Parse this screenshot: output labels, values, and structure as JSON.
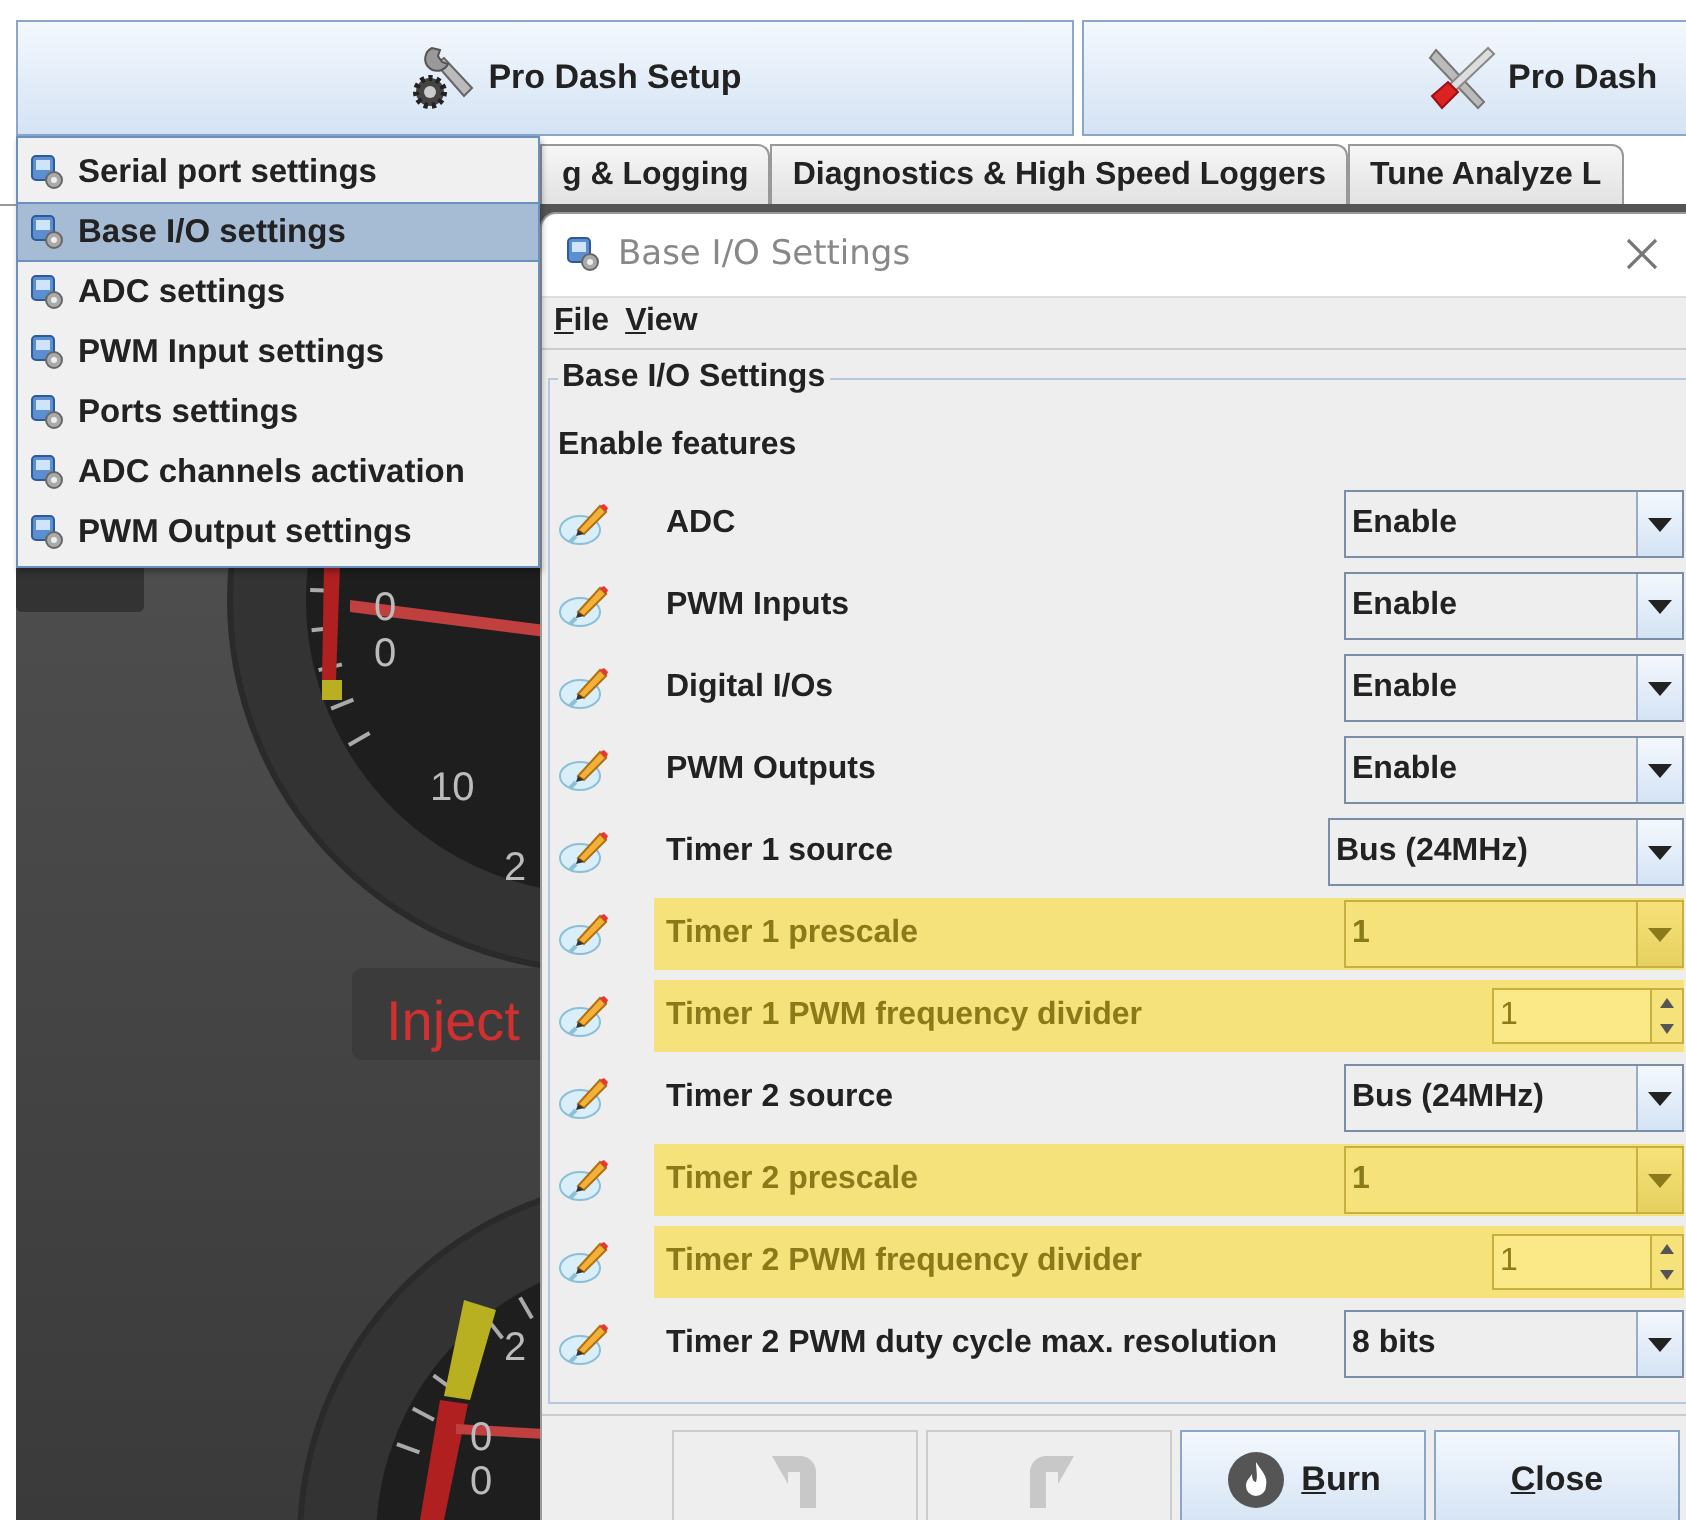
{
  "toolbar": {
    "buttons": [
      {
        "label": "Pro Dash Setup"
      },
      {
        "label": "Pro Dash"
      }
    ]
  },
  "tabs": [
    {
      "label": "g & Logging",
      "selected": false
    },
    {
      "label": "Diagnostics & High Speed Loggers",
      "selected": false
    },
    {
      "label": "Tune Analyze L",
      "selected": false
    }
  ],
  "popup_menu": {
    "items": [
      {
        "label": "Serial port settings",
        "selected": false
      },
      {
        "label": "Base I/O settings",
        "selected": true
      },
      {
        "label": "ADC settings",
        "selected": false
      },
      {
        "label": "PWM Input settings",
        "selected": false
      },
      {
        "label": "Ports settings",
        "selected": false
      },
      {
        "label": "ADC channels activation",
        "selected": false
      },
      {
        "label": "PWM Output settings",
        "selected": false
      }
    ]
  },
  "dashboard": {
    "gauges": [
      {
        "labels": [
          "0",
          "0",
          "10",
          "2"
        ]
      },
      {
        "labels": [
          "2",
          "0",
          "0"
        ]
      }
    ],
    "indicator": "Inject"
  },
  "dialog": {
    "title": "Base I/O Settings",
    "menu": [
      {
        "label": "File"
      },
      {
        "label": "View"
      }
    ],
    "group_title": "Base I/O Settings",
    "section": "Enable features",
    "rows": [
      {
        "kind": "combo",
        "label": "ADC",
        "value": "Enable",
        "highlighted": false
      },
      {
        "kind": "combo",
        "label": "PWM Inputs",
        "value": "Enable",
        "highlighted": false
      },
      {
        "kind": "combo",
        "label": "Digital I/Os",
        "value": "Enable",
        "highlighted": false
      },
      {
        "kind": "combo",
        "label": "PWM Outputs",
        "value": "Enable",
        "highlighted": false
      },
      {
        "kind": "combo",
        "label": "Timer 1 source",
        "value": "Bus (24MHz)",
        "highlighted": false
      },
      {
        "kind": "combo",
        "label": "Timer 1 prescale",
        "value": "1",
        "highlighted": true
      },
      {
        "kind": "spinner",
        "label": "Timer 1 PWM frequency divider",
        "value": "1",
        "highlighted": true
      },
      {
        "kind": "combo",
        "label": "Timer 2 source",
        "value": "Bus (24MHz)",
        "highlighted": false
      },
      {
        "kind": "combo",
        "label": "Timer 2 prescale",
        "value": "1",
        "highlighted": true
      },
      {
        "kind": "spinner",
        "label": "Timer 2 PWM frequency divider",
        "value": "1",
        "highlighted": true
      },
      {
        "kind": "combo",
        "label": "Timer 2 PWM duty cycle max. resolution",
        "value": "8 bits",
        "highlighted": false
      }
    ],
    "buttons": [
      {
        "kind": "undo",
        "disabled": true
      },
      {
        "kind": "redo",
        "disabled": true
      },
      {
        "kind": "burn",
        "label": "Burn",
        "disabled": false
      },
      {
        "kind": "close",
        "label": "Close",
        "disabled": false
      }
    ]
  }
}
